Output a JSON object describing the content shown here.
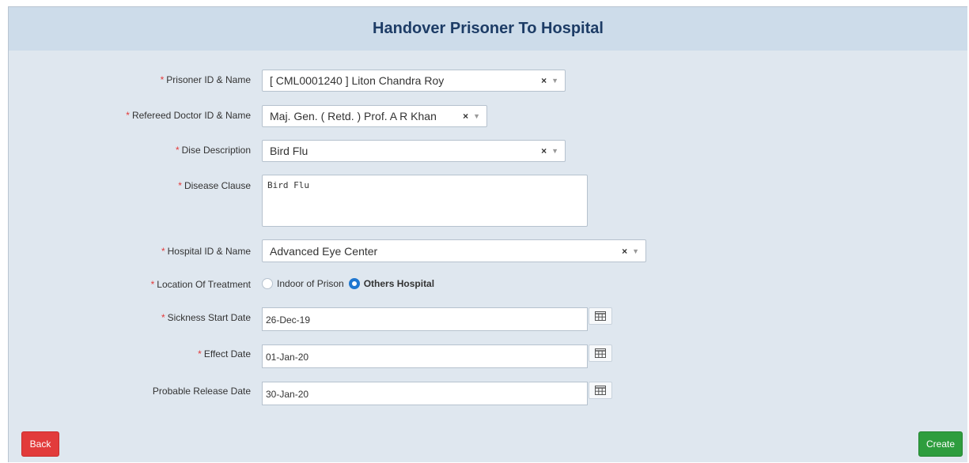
{
  "header": {
    "title": "Handover Prisoner To Hospital"
  },
  "required_mark": "*",
  "fields": {
    "prisoner": {
      "label": "Prisoner ID & Name",
      "value": "[ CML0001240 ] Liton Chandra Roy",
      "clear": "×",
      "arrow": "▼"
    },
    "doctor": {
      "label": "Refereed Doctor ID & Name",
      "value": "Maj. Gen. ( Retd. ) Prof. A R Khan",
      "clear": "×",
      "arrow": "▼"
    },
    "dise": {
      "label": "Dise Description",
      "value": "Bird Flu",
      "clear": "×",
      "arrow": "▼"
    },
    "clause": {
      "label": "Disease Clause",
      "value": "Bird Flu"
    },
    "hospital": {
      "label": "Hospital ID & Name",
      "value": "Advanced Eye Center",
      "clear": "×",
      "arrow": "▼"
    },
    "location": {
      "label": "Location Of Treatment",
      "options": [
        "Indoor of Prison",
        "Others Hospital"
      ],
      "selected": "Others Hospital"
    },
    "sickness_start": {
      "label": "Sickness Start Date",
      "value": "26-Dec-19",
      "icon": "calendar-icon"
    },
    "effect_date": {
      "label": "Effect Date",
      "value": "01-Jan-20",
      "icon": "calendar-icon"
    },
    "release_date": {
      "label": "Probable Release Date",
      "value": "30-Jan-20",
      "icon": "calendar-icon"
    }
  },
  "buttons": {
    "back": "Back",
    "create": "Create"
  },
  "colors": {
    "back": "#e23b3b",
    "create": "#2e9d3e",
    "title": "#1d3c66",
    "radio_selected": "#1f77d0"
  }
}
